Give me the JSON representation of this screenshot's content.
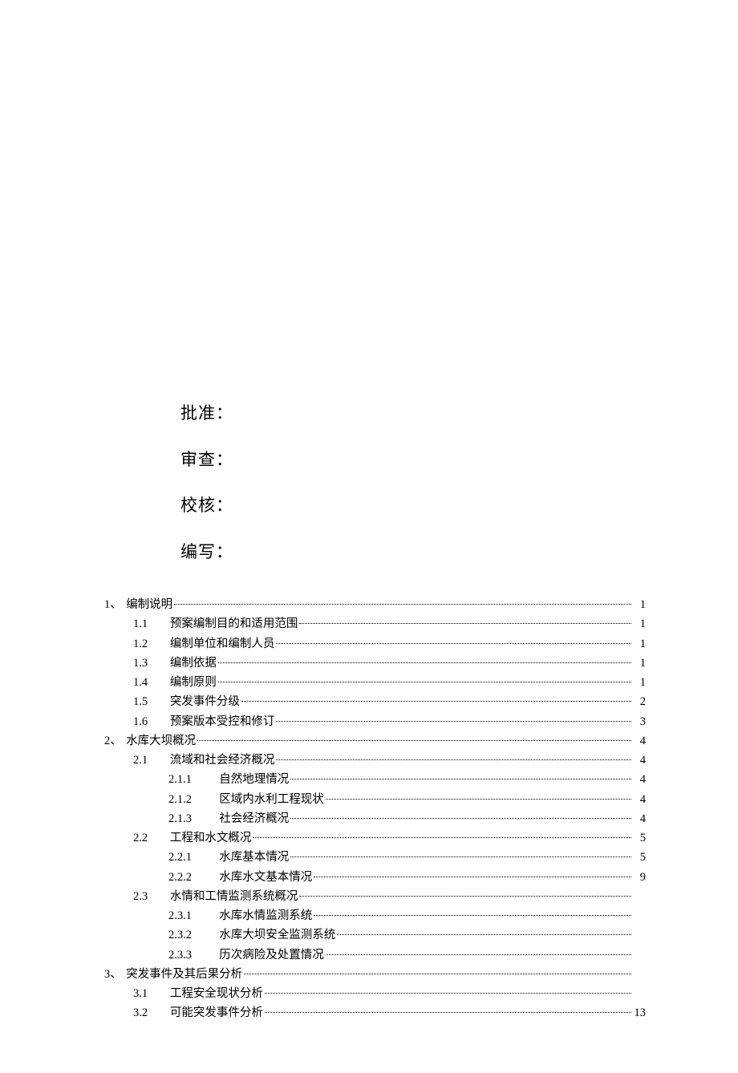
{
  "signoff": {
    "approve": "批准：",
    "review": "审查：",
    "check": "校核：",
    "write": "编写："
  },
  "toc": [
    {
      "lvl": 1,
      "num": "1、",
      "title": "编制说明",
      "page": "1"
    },
    {
      "lvl": 2,
      "num": "1.1",
      "title": "预案编制目的和适用范围",
      "page": "1"
    },
    {
      "lvl": 2,
      "num": "1.2",
      "title": "编制单位和编制人员",
      "page": "1"
    },
    {
      "lvl": 2,
      "num": "1.3",
      "title": "编制依据",
      "page": "1"
    },
    {
      "lvl": 2,
      "num": "1.4",
      "title": "编制原则",
      "page": "1"
    },
    {
      "lvl": 2,
      "num": "1.5",
      "title": "突发事件分级",
      "page": "2"
    },
    {
      "lvl": 2,
      "num": "1.6",
      "title": "预案版本受控和修订",
      "page": "3"
    },
    {
      "lvl": 1,
      "num": "2、",
      "title": "水库大坝概况",
      "page": "4"
    },
    {
      "lvl": 2,
      "num": "2.1",
      "title": "流域和社会经济概况",
      "page": "4"
    },
    {
      "lvl": 3,
      "num": "2.1.1",
      "title": "自然地理情况",
      "page": "4"
    },
    {
      "lvl": 3,
      "num": "2.1.2",
      "title": "区域内水利工程现状",
      "page": "4"
    },
    {
      "lvl": 3,
      "num": "2.1.3",
      "title": "社会经济概况",
      "page": "4"
    },
    {
      "lvl": 2,
      "num": "2.2",
      "title": "工程和水文概况",
      "page": "5"
    },
    {
      "lvl": 3,
      "num": "2.2.1",
      "title": "水库基本情况",
      "page": "5"
    },
    {
      "lvl": 3,
      "num": "2.2.2",
      "title": "水库水文基本情况",
      "page": "9"
    },
    {
      "lvl": 2,
      "num": "2.3",
      "title": "水情和工情监测系统概况",
      "page": ""
    },
    {
      "lvl": 3,
      "num": "2.3.1",
      "title": "水库水情监测系统",
      "page": ""
    },
    {
      "lvl": 3,
      "num": "2.3.2",
      "title": "水库大坝安全监测系统",
      "page": ""
    },
    {
      "lvl": 3,
      "num": "2.3.3",
      "title": "历次病险及处置情况",
      "page": ""
    },
    {
      "lvl": 1,
      "num": "3、",
      "title": "突发事件及其后果分析",
      "page": ""
    },
    {
      "lvl": 2,
      "num": "3.1",
      "title": "工程安全现状分析",
      "page": ""
    },
    {
      "lvl": 2,
      "num": "3.2",
      "title": "可能突发事件分析",
      "page": "13"
    }
  ]
}
